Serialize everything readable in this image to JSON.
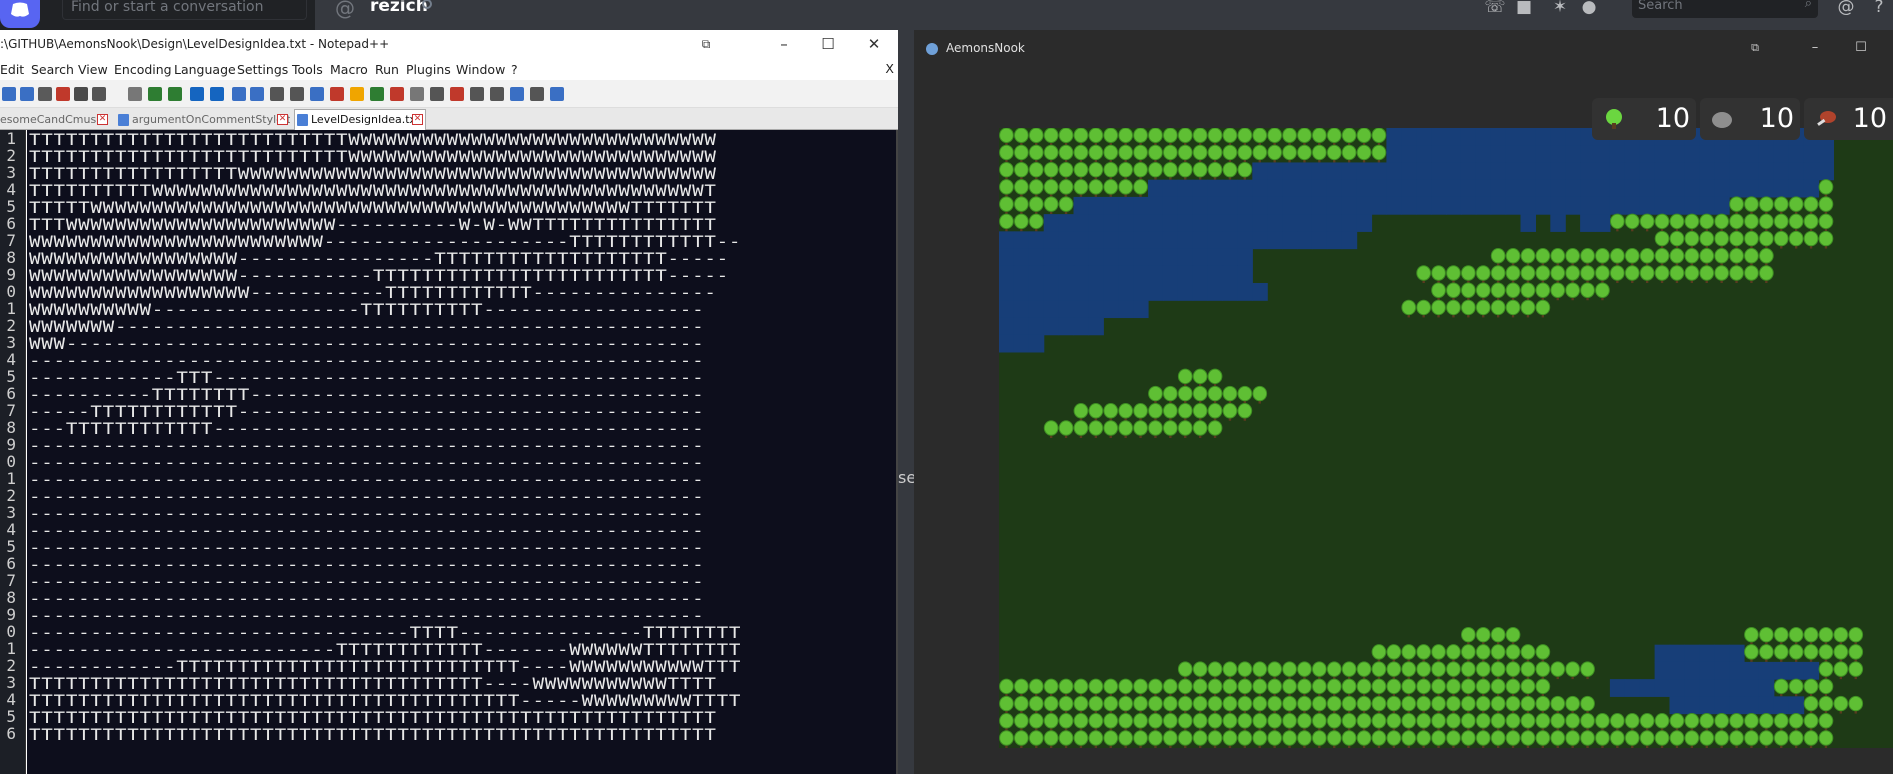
{
  "discord": {
    "search_placeholder": "Find or start a conversation",
    "channel_at": "@",
    "channel_name": "rezich",
    "search2_placeholder": "Search",
    "icons": [
      "discord-logo",
      "call-icon",
      "video-icon",
      "pin-icon",
      "add-friend-icon",
      "search-icon",
      "mention-icon",
      "help-icon"
    ]
  },
  "npp": {
    "title": ":\\GITHUB\\AemonsNook\\Design\\LevelDesignIdea.txt - Notepad++",
    "menu": [
      "Edit",
      "Search",
      "View",
      "Encoding",
      "Language",
      "Settings",
      "Tools",
      "Macro",
      "Run",
      "Plugins",
      "Window",
      "?"
    ],
    "menu_close": "X",
    "tabs": [
      {
        "label": "esomeCandCmusic",
        "active": false
      },
      {
        "label": "argumentOnCommentStyle.txt",
        "active": false
      },
      {
        "label": "LevelDesignIdea.txt",
        "active": true
      }
    ],
    "line_numbers": [
      "1",
      "2",
      "3",
      "4",
      "5",
      "6",
      "7",
      "8",
      "9",
      "0",
      "1",
      "2",
      "3",
      "4",
      "5",
      "6",
      "7",
      "8",
      "9",
      "0",
      "1",
      "2",
      "3",
      "4",
      "5",
      "6",
      "7",
      "8",
      "9",
      "0",
      "1",
      "2",
      "3",
      "4",
      "5",
      "6"
    ],
    "lines": [
      "TTTTTTTTTTTTTTTTTTTTTTTTTTWWWWWWWWWWWWWWWWWWWWWWWWWWWWWW",
      "TTTTTTTTTTTTTTTTTTTTTTTTTTWWWWWWWWWWWWWWWWWWWWWWWWWWWWWW",
      "TTTTTTTTTTTTTTTTTWWWWWWWWWWWWWWWWWWWWWWWWWWWWWWWWWWWWWWW",
      "TTTTTTTTTTWWWWWWWWWWWWWWWWWWWWWWWWWWWWWWWWWWWWWWWWWWWWWT",
      "TTTTTWWWWWWWWWWWWWWWWWWWWWWWWWWWWWWWWWWWWWWWWWWWWTTTTTTT",
      "TTTWWWWWWWWWWWWWWWWWWWWWW----------W-W-WWTTTTTTTTTTTTTTT",
      "WWWWWWWWWWWWWWWWWWWWWWWW--------------------TTTTTTTTTTTT--",
      "WWWWWWWWWWWWWWWWW----------------TTTTTTTTTTTTTTTTTTT-----",
      "WWWWWWWWWWWWWWWWW-----------TTTTTTTTTTTTTTTTTTTTTTTT-----",
      "WWWWWWWWWWWWWWWWWW-----------TTTTTTTTTTTT---------------",
      "WWWWWWWWWW-----------------TTTTTTTTTT------------------",
      "WWWWWWW------------------------------------------------",
      "WWW----------------------------------------------------",
      "-------------------------------------------------------",
      "------------TTT----------------------------------------",
      "----------TTTTTTTT-------------------------------------",
      "-----TTTTTTTTTTTT--------------------------------------",
      "---TTTTTTTTTTTT----------------------------------------",
      "-------------------------------------------------------",
      "-------------------------------------------------------",
      "-------------------------------------------------------",
      "-------------------------------------------------------",
      "-------------------------------------------------------",
      "-------------------------------------------------------",
      "-------------------------------------------------------",
      "-------------------------------------------------------",
      "-------------------------------------------------------",
      "-------------------------------------------------------",
      "-------------------------------------------------------",
      "-------------------------------TTTT---------------TTTTTTTT",
      "-------------------------TTTTTTTTTTTT-------WWWWWWTTTTTTTT",
      "------------TTTTTTTTTTTTTTTTTTTTTTTTTTTT----WWWWWWWWWWWTTT",
      "TTTTTTTTTTTTTTTTTTTTTTTTTTTTTTTTTTTTT----WWWWWWWWWWWTTTT",
      "TTTTTTTTTTTTTTTTTTTTTTTTTTTTTTTTTTTTTTTT-----WWWWWWWWWTTTT",
      "TTTTTTTTTTTTTTTTTTTTTTTTTTTTTTTTTTTTTTTTTTTTTTTTTTTTTTTT",
      "TTTTTTTTTTTTTTTTTTTTTTTTTTTTTTTTTTTTTTTTTTTTTTTTTTTTTTTT"
    ]
  },
  "separator_text": "se",
  "game": {
    "title": "AemonsNook",
    "resources": [
      {
        "name": "wood-icon",
        "count": "10",
        "color": "#6bd640"
      },
      {
        "name": "stone-icon",
        "count": "10",
        "color": "#8e8e8e"
      },
      {
        "name": "meat-icon",
        "count": "10",
        "color": "#b0432c"
      }
    ],
    "grid_cols": 60,
    "grid_rows": 36,
    "colors": {
      "water": "#173e78",
      "grass": "#1e3a16",
      "tree": "#5fbf34",
      "tree_dark": "#3e8f22",
      "trunk": "#5a3b1f"
    }
  }
}
